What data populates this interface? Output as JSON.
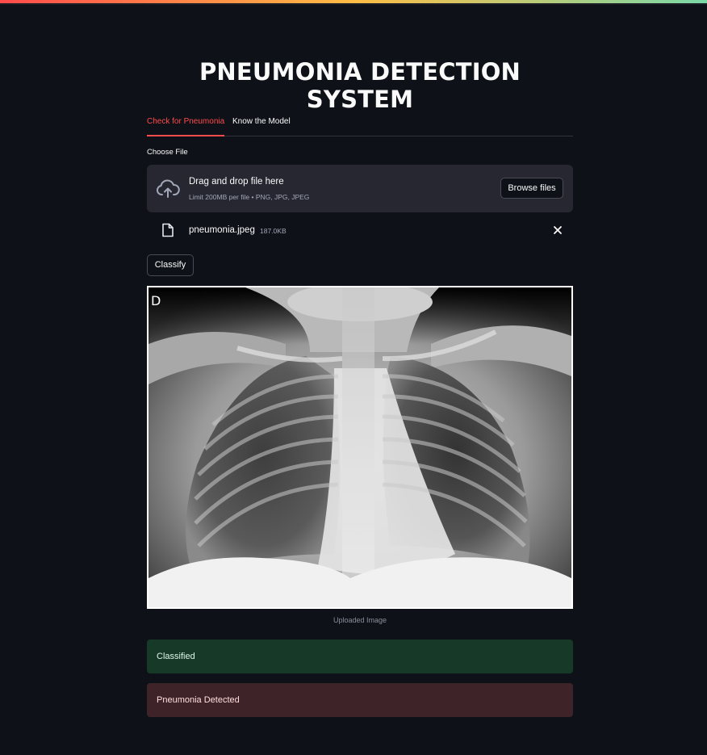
{
  "app": {
    "title": "PNEUMONIA DETECTION SYSTEM"
  },
  "tabs": [
    {
      "label": "Check for Pneumonia",
      "active": true
    },
    {
      "label": "Know the Model",
      "active": false
    }
  ],
  "uploader": {
    "label": "Choose File",
    "drop_text": "Drag and drop file here",
    "limit_text": "Limit 200MB per file • PNG, JPG, JPEG",
    "browse_label": "Browse files",
    "icon": "cloud-upload-icon"
  },
  "file": {
    "name": "pneumonia.jpeg",
    "size": "187.0KB",
    "icon": "file-icon",
    "remove_icon": "close-icon"
  },
  "classify_button": {
    "label": "Classify"
  },
  "image": {
    "caption": "Uploaded Image",
    "corner_letter": "D"
  },
  "alerts": {
    "success": "Classified",
    "error": "Pneumonia Detected"
  },
  "colors": {
    "background": "#0e1117",
    "accent": "#ff4b4b",
    "panel": "#262730",
    "success_bg": "#173928",
    "error_bg": "#3e2428"
  }
}
